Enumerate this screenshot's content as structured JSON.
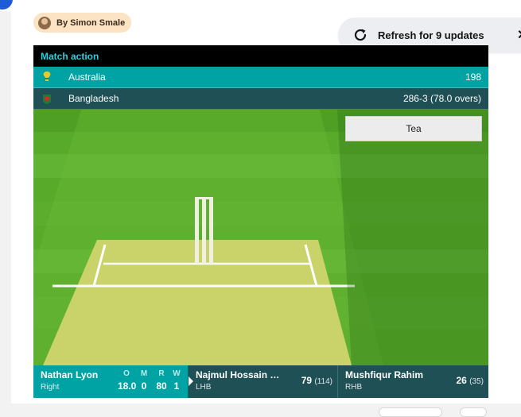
{
  "byline": {
    "text": "By Simon Smale"
  },
  "refresh": {
    "label": "Refresh for 9 updates",
    "close": "✕"
  },
  "match": {
    "header": "Match action",
    "teams": [
      {
        "name": "Australia",
        "score": "198",
        "flag": "australia-flag-icon"
      },
      {
        "name": "Bangladesh",
        "score": "286-3 (78.0 overs)",
        "flag": "bangladesh-flag-icon"
      }
    ],
    "status": "Tea",
    "bowler": {
      "name": "Nathan Lyon",
      "style": "Right",
      "figures_headers": [
        "O",
        "M",
        "R",
        "W"
      ],
      "figures": [
        "18.0",
        "0",
        "80",
        "1"
      ]
    },
    "batters": [
      {
        "name": "Najmul Hossain …",
        "hand": "LHB",
        "runs": "79",
        "balls": "(114)",
        "on_strike": true
      },
      {
        "name": "Mushfiqur Rahim",
        "hand": "RHB",
        "runs": "26",
        "balls": "(35)",
        "on_strike": false
      }
    ]
  },
  "colors": {
    "teal": "#00a3a3",
    "dark_teal": "#1f5055",
    "header_text": "#1fd3e0",
    "grass": "#58aa2a",
    "pitch": "#c9d36a"
  }
}
